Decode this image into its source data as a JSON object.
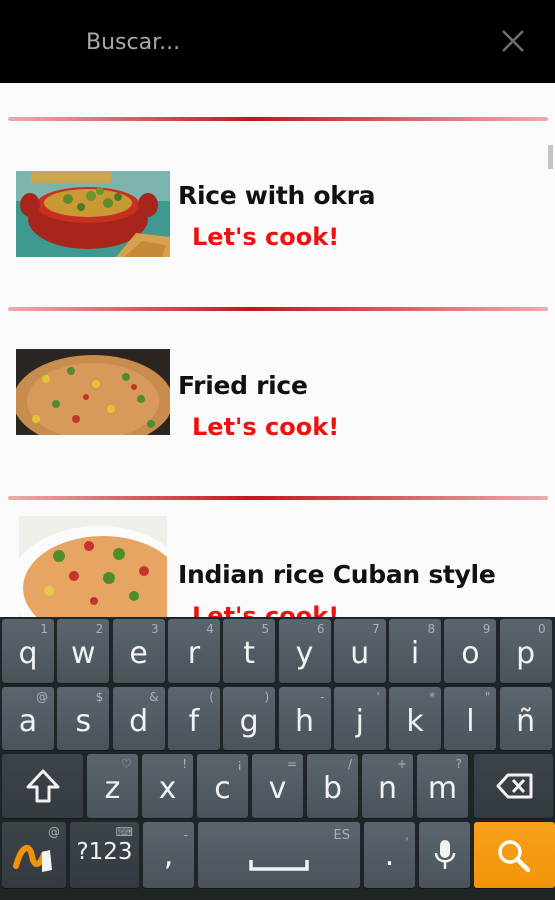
{
  "search": {
    "placeholder": "Buscar..."
  },
  "recipes": [
    {
      "title": "Rice with okra",
      "action": "Let's cook!"
    },
    {
      "title": "Fried rice",
      "action": "Let's cook!"
    },
    {
      "title": "Indian rice Cuban style",
      "action": "Let's cook!"
    }
  ],
  "keyboard": {
    "row1": [
      {
        "k": "q",
        "h": "1"
      },
      {
        "k": "w",
        "h": "2"
      },
      {
        "k": "e",
        "h": "3"
      },
      {
        "k": "r",
        "h": "4"
      },
      {
        "k": "t",
        "h": "5"
      },
      {
        "k": "y",
        "h": "6"
      },
      {
        "k": "u",
        "h": "7"
      },
      {
        "k": "i",
        "h": "8"
      },
      {
        "k": "o",
        "h": "9"
      },
      {
        "k": "p",
        "h": "0"
      }
    ],
    "row2": [
      {
        "k": "a",
        "h": "@"
      },
      {
        "k": "s",
        "h": "$"
      },
      {
        "k": "d",
        "h": "&"
      },
      {
        "k": "f",
        "h": "("
      },
      {
        "k": "g",
        "h": ")"
      },
      {
        "k": "h",
        "h": "-"
      },
      {
        "k": "j",
        "h": "'"
      },
      {
        "k": "k",
        "h": "*"
      },
      {
        "k": "l",
        "h": "\""
      },
      {
        "k": "ñ",
        "h": ""
      }
    ],
    "row3": [
      {
        "k": "z",
        "h": "♡"
      },
      {
        "k": "x",
        "h": "!"
      },
      {
        "k": "c",
        "h": "¡"
      },
      {
        "k": "v",
        "h": "="
      },
      {
        "k": "b",
        "h": "/"
      },
      {
        "k": "n",
        "h": "+"
      },
      {
        "k": "m",
        "h": "?"
      }
    ],
    "symbols_label": "?123",
    "comma_label": ",",
    "comma_hint": "-",
    "language_label": "ES",
    "period_label": ".",
    "period_hint": ",",
    "colors": {
      "accent": "#f29408",
      "key": "#4f585f",
      "background": "#1f2427"
    }
  }
}
